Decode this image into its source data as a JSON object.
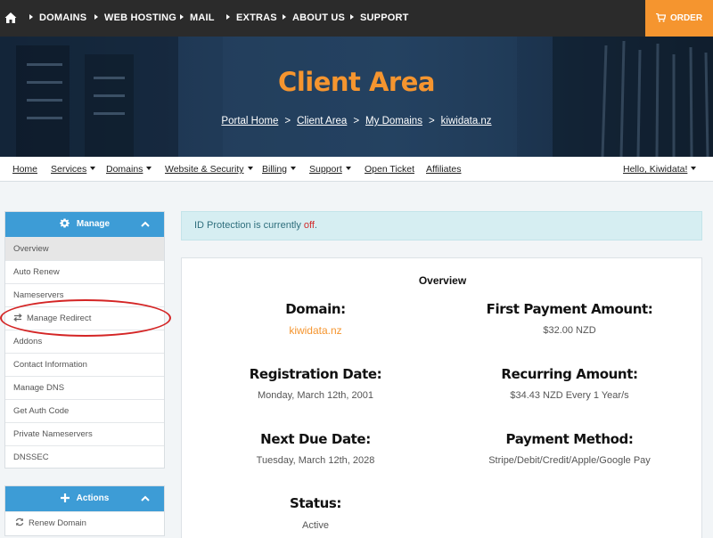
{
  "topnav": {
    "home_icon": "home-icon",
    "items": [
      "DOMAINS",
      "WEB HOSTING",
      "MAIL",
      "EXTRAS",
      "ABOUT US",
      "SUPPORT"
    ],
    "order_label": "ORDER",
    "order_icon": "cart-icon",
    "order_color": "#f5952f"
  },
  "hero": {
    "title": "Client Area",
    "breadcrumb": [
      "Portal Home",
      "Client Area",
      "My Domains",
      "kiwidata.nz"
    ],
    "separator": ">"
  },
  "subnav": {
    "items": [
      {
        "label": "Home",
        "dropdown": false
      },
      {
        "label": "Services",
        "dropdown": true
      },
      {
        "label": "Domains",
        "dropdown": true
      },
      {
        "label": "Website & Security",
        "dropdown": true
      },
      {
        "label": "Billing",
        "dropdown": true
      },
      {
        "label": "Support",
        "dropdown": true
      },
      {
        "label": "Open Ticket",
        "dropdown": false
      },
      {
        "label": "Affiliates",
        "dropdown": false
      }
    ],
    "greeting": "Hello, Kiwidata!"
  },
  "sidebar": {
    "manage": {
      "title": "Manage",
      "icon": "gear-icon",
      "items": [
        "Overview",
        "Auto Renew",
        "Nameservers",
        "Manage Redirect",
        "Addons",
        "Contact Information",
        "Manage DNS",
        "Get Auth Code",
        "Private Nameservers",
        "DNSSEC"
      ],
      "active_item": "Overview",
      "highlighted_item": "Manage Redirect"
    },
    "actions": {
      "title": "Actions",
      "icon": "plus-icon",
      "items": [
        "Renew Domain"
      ]
    }
  },
  "alert": {
    "text_before": "ID Protection is currently ",
    "status": "off",
    "text_after": "."
  },
  "overview": {
    "title": "Overview",
    "domain_label": "Domain:",
    "domain_value": "kiwidata.nz",
    "first_payment_label": "First Payment Amount:",
    "first_payment_value": "$32.00 NZD",
    "registration_label": "Registration Date:",
    "registration_value": "Monday, March 12th, 2001",
    "recurring_label": "Recurring Amount:",
    "recurring_value": "$34.43 NZD Every 1 Year/s",
    "next_due_label": "Next Due Date:",
    "next_due_value": "Tuesday, March 12th, 2028",
    "payment_method_label": "Payment Method:",
    "payment_method_value": "Stripe/Debit/Credit/Apple/Google Pay",
    "status_label": "Status:",
    "status_value": "Active"
  }
}
